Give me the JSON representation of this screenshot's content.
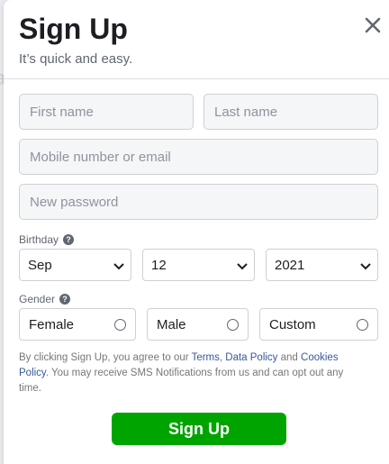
{
  "backdrop": {
    "fragment_1": "a",
    "fragment_2": ""
  },
  "dialog": {
    "title": "Sign Up",
    "subtitle": "It’s quick and easy.",
    "close_icon": "close-icon"
  },
  "form": {
    "first_name_placeholder": "First name",
    "last_name_placeholder": "Last name",
    "mobile_email_placeholder": "Mobile number or email",
    "password_placeholder": "New password",
    "birthday_label": "Birthday",
    "birthday_month": "Sep",
    "birthday_day": "12",
    "birthday_year": "2021",
    "gender_label": "Gender",
    "gender_options": [
      "Female",
      "Male",
      "Custom"
    ],
    "help_icon": "question-circle-icon"
  },
  "terms": {
    "part1": "By clicking Sign Up, you agree to our ",
    "terms_link": "Terms",
    "comma": ", ",
    "data_policy_link": "Data Policy",
    "and": " and ",
    "cookies_link": "Cookies Policy",
    "part2": ". You may receive SMS Notifications from us and can opt out any time."
  },
  "signup_button_label": "Sign Up",
  "colors": {
    "accent_green": "#00a400",
    "link_blue": "#385898"
  }
}
